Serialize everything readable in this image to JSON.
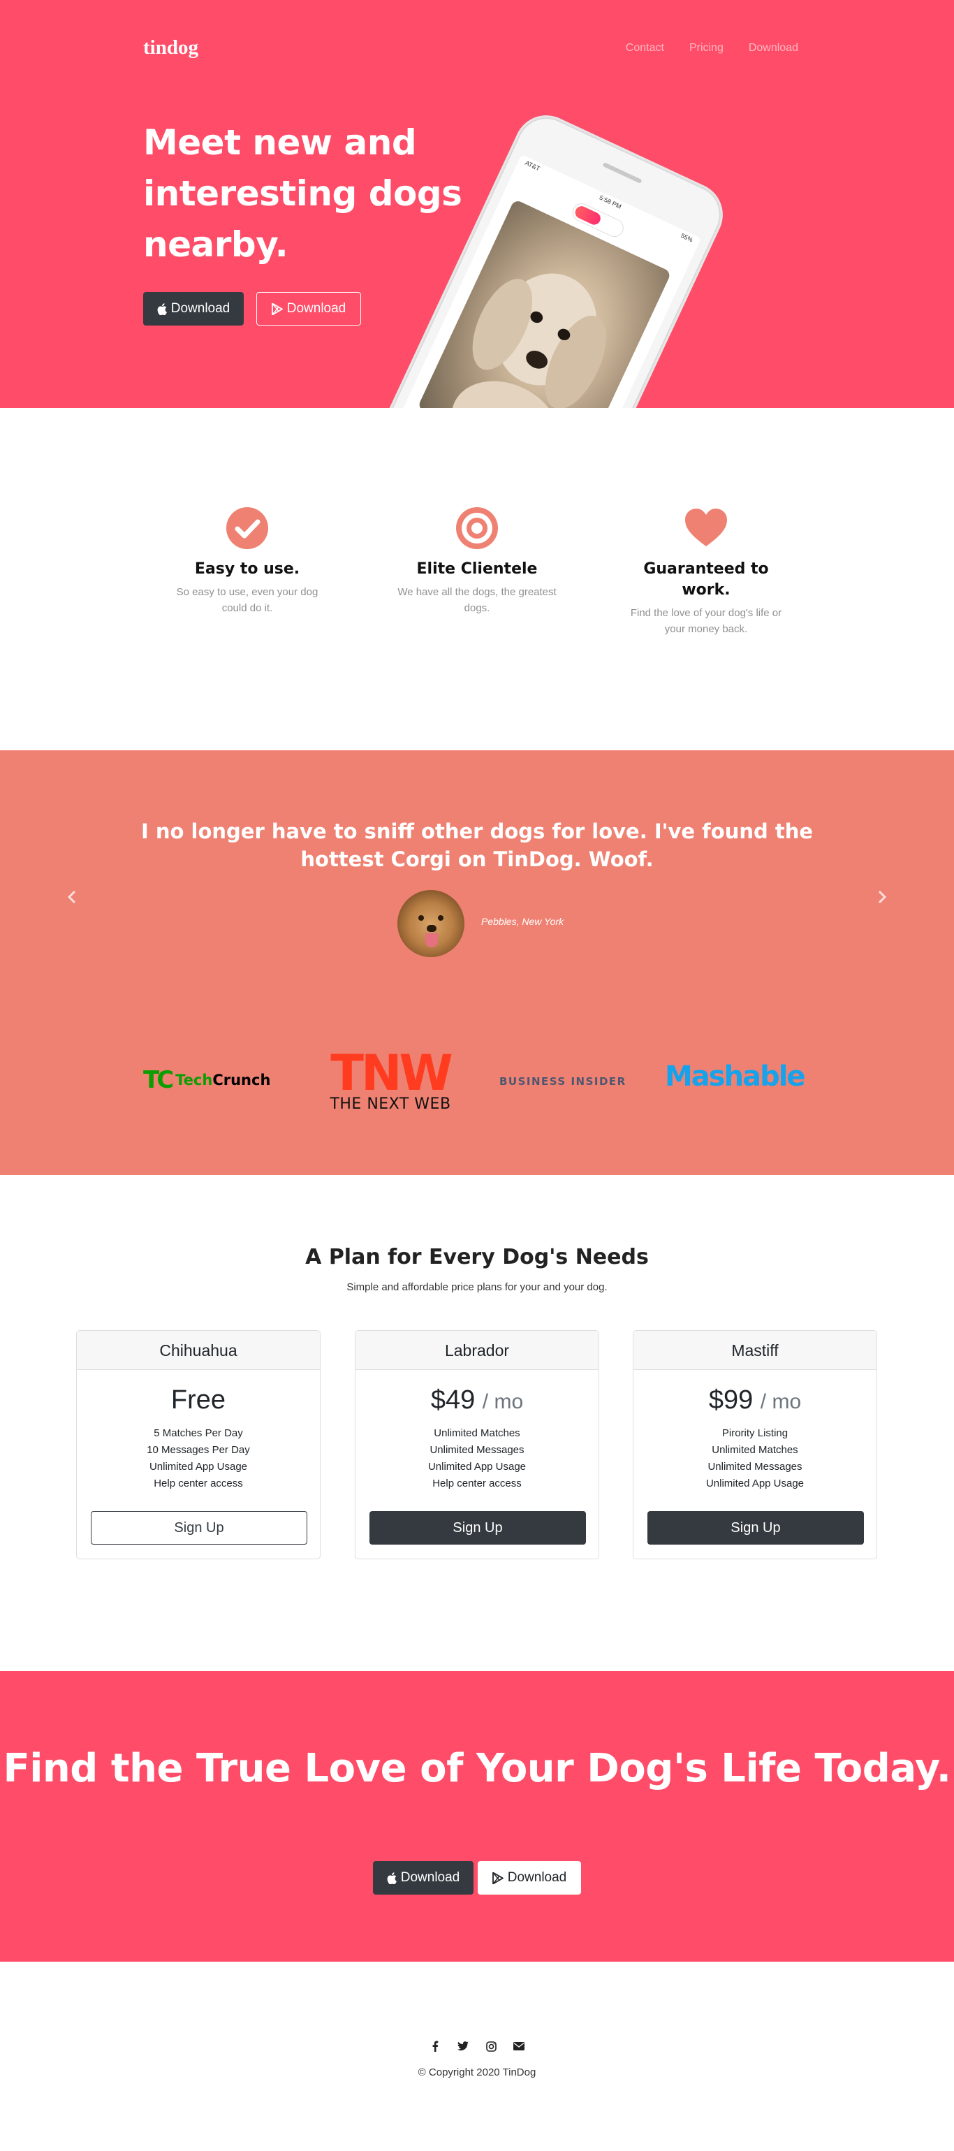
{
  "brand": {
    "name": "tindog"
  },
  "nav": {
    "items": [
      "Contact",
      "Pricing",
      "Download"
    ]
  },
  "hero": {
    "title": "Meet new and interesting dogs nearby.",
    "apple_button": "Download",
    "google_button": "Download",
    "phone_status": {
      "carrier": "AT&T",
      "time": "5:58 PM",
      "battery": "55%"
    }
  },
  "features": [
    {
      "icon": "check-circle-icon",
      "title": "Easy to use.",
      "text": "So easy to use, even your dog could do it."
    },
    {
      "icon": "bullseye-icon",
      "title": "Elite Clientele",
      "text": "We have all the dogs, the greatest dogs."
    },
    {
      "icon": "heart-icon",
      "title": "Guaranteed to work.",
      "text": "Find the love of your dog's life or your money back."
    }
  ],
  "testimonial": {
    "quote": "I no longer have to sniff other dogs for love. I've found the hottest Corgi on TinDog. Woof.",
    "caption": "Pebbles, New York"
  },
  "press": {
    "techcrunch_mark": "TC",
    "techcrunch_word_a": "Tech",
    "techcrunch_word_b": "Crunch",
    "tnw_mark": "TNW",
    "tnw_sub": "THE NEXT WEB",
    "business_insider": "BUSINESS INSIDER",
    "mashable": "Mashable"
  },
  "pricing": {
    "title": "A Plan for Every Dog's Needs",
    "subtitle": "Simple and affordable price plans for your and your dog.",
    "plans": [
      {
        "name": "Chihuahua",
        "price": "Free",
        "per": "",
        "features": [
          "5 Matches Per Day",
          "10 Messages Per Day",
          "Unlimited App Usage",
          "Help center access"
        ],
        "button": "Sign Up"
      },
      {
        "name": "Labrador",
        "price": "$49",
        "per": "/ mo",
        "features": [
          "Unlimited Matches",
          "Unlimited Messages",
          "Unlimited App Usage",
          "Help center access"
        ],
        "button": "Sign Up"
      },
      {
        "name": "Mastiff",
        "price": "$99",
        "per": "/ mo",
        "features": [
          "Pirority Listing",
          "Unlimited Matches",
          "Unlimited Messages",
          "Unlimited App Usage"
        ],
        "button": "Sign Up"
      }
    ]
  },
  "cta": {
    "title": "Find the True Love of Your Dog's Life Today.",
    "apple_button": "Download",
    "google_button": "Download"
  },
  "footer": {
    "social_icons": [
      "facebook-icon",
      "twitter-icon",
      "instagram-icon",
      "envelope-icon"
    ],
    "copyright": "© Copyright 2020 TinDog"
  },
  "colors": {
    "hero": "#ff4c68",
    "testimonial": "#ef8172",
    "icon": "#ef8172",
    "dark_button": "#343a40"
  }
}
